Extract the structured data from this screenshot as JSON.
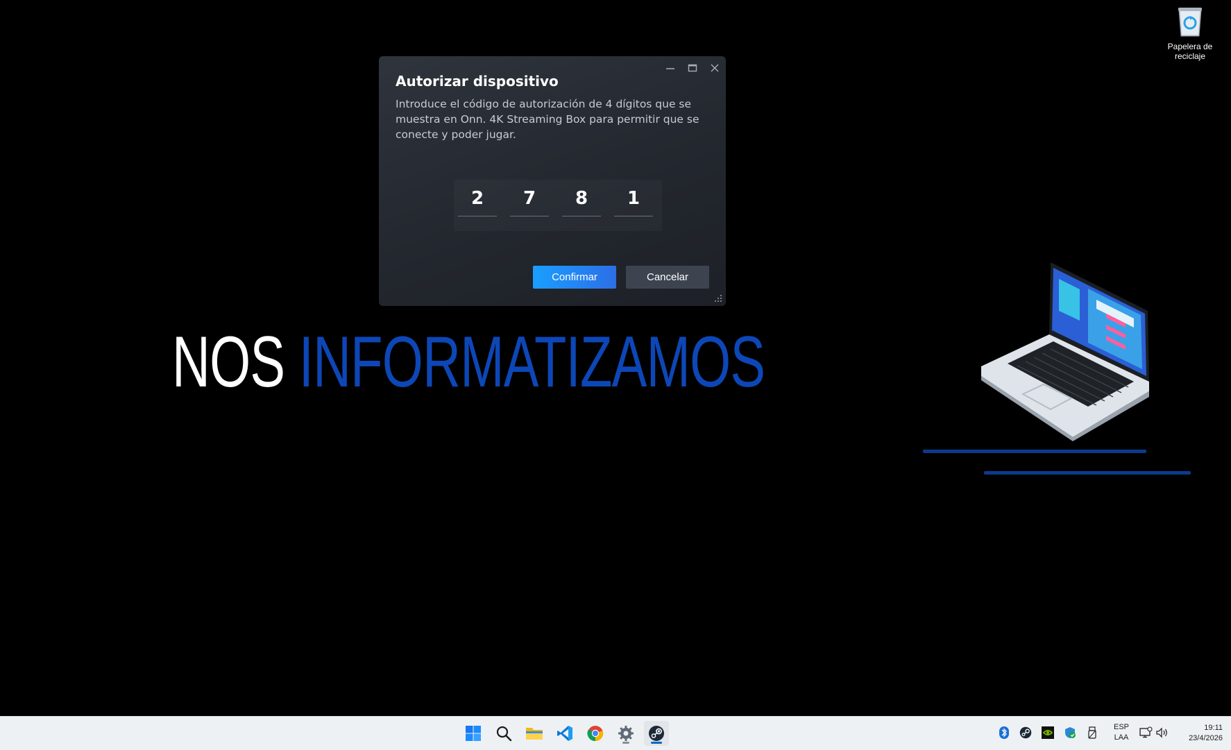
{
  "desktop": {
    "recycle_bin_label": "Papelera de reciclaje",
    "wallpaper": {
      "brand_word1": "NOS",
      "brand_word2": "INFORMATIZAMOS",
      "accent_color": "#0d47b7"
    }
  },
  "dialog": {
    "title": "Autorizar dispositivo",
    "description": "Introduce el código de autorización de 4 dígitos que se muestra en Onn. 4K Streaming Box para permitir que se conecte y poder jugar.",
    "code_digits": [
      "2",
      "7",
      "8",
      "1"
    ],
    "confirm_label": "Confirmar",
    "cancel_label": "Cancelar",
    "accent_color": "#1a9fff",
    "window_controls": [
      "minimize-icon",
      "maximize-icon",
      "close-icon"
    ]
  },
  "taskbar": {
    "apps": [
      "start-icon",
      "search-icon",
      "file-explorer-icon",
      "vscode-icon",
      "chrome-icon",
      "settings-icon",
      "steam-icon"
    ],
    "tray_icons": [
      "bluetooth-icon",
      "steam-tray-icon",
      "nvidia-icon",
      "security-icon",
      "usb-icon"
    ],
    "language": {
      "line1": "ESP",
      "line2": "LAA"
    },
    "clock": {
      "time": "19:11",
      "date": "23/4/2026"
    }
  }
}
